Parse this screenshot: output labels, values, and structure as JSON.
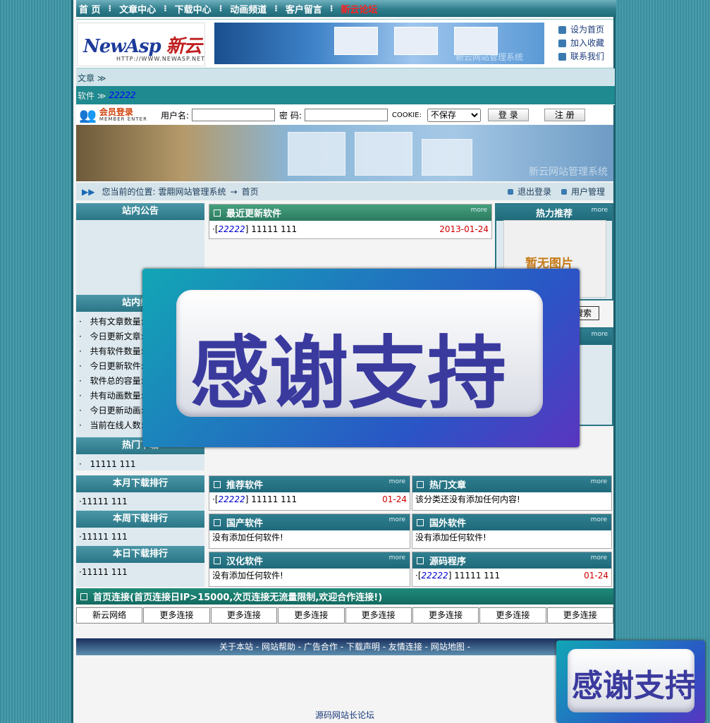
{
  "nav": {
    "items": [
      "首 页",
      "文章中心",
      "下载中心",
      "动画频道",
      "客户留言"
    ],
    "hot": "新云论坛",
    "sep": "⁝"
  },
  "banner": {
    "logo_main": "NewAsp",
    "logo_cn": "新云",
    "logo_url": "HTTP://WWW.NEWASP.NET",
    "img_caption": "新云网站管理系统",
    "quick": [
      "设为首页",
      "加入收藏",
      "联系我们"
    ]
  },
  "crumbs": {
    "article": "文章 ≫",
    "software": "软件 ≫",
    "software_sub": "22222"
  },
  "login": {
    "title": "会员登录",
    "subtitle": "MEMBER ENTER",
    "user_label": "用户名:",
    "pass_label": "密 码:",
    "cookie_label": "COOKIE:",
    "cookie_value": "不保存",
    "login_btn": "登 录",
    "register_btn": "注 册"
  },
  "photo_caption": "新云网站管理系统",
  "position": {
    "prefix": "您当前的位置:",
    "site": "雲翢网站管理系统",
    "arrow": "→",
    "page": "首页",
    "logout": "退出登录",
    "usermgr": "用户管理"
  },
  "left": {
    "notice_title": "站内公告",
    "stats_title": "站内统计",
    "stats": [
      "共有文章数量:",
      "今日更新文章:",
      "共有软件数量:",
      "今日更新软件:",
      "软件总的容量:",
      "共有动画数量:",
      "今日更新动画:",
      "当前在线人数:"
    ],
    "hot_title": "热门下载",
    "hot_items": [
      "11111 111"
    ],
    "month_title": "本月下载排行",
    "month_items": [
      "11111 111"
    ],
    "week_title": "本周下载排行",
    "week_items": [
      "11111 111"
    ],
    "day_title": "本日下载排行",
    "day_items": [
      "11111 111"
    ]
  },
  "recent": {
    "title": "最近更新软件",
    "more": "more",
    "items": [
      {
        "cat": "22222",
        "name": "11111 111",
        "date": "2013-01-24"
      }
    ]
  },
  "right": {
    "hot_title": "热力推荐",
    "more": "more",
    "noimg": "暂无图片",
    "search_btn": "搜索"
  },
  "sections": {
    "recommend": {
      "title": "推荐软件",
      "cat": "22222",
      "name": "11111 111",
      "date": "01-24"
    },
    "hot_article": {
      "title": "热门文章",
      "empty": "该分类还没有添加任何内容!"
    },
    "domestic": {
      "title": "国产软件",
      "empty": "没有添加任何软件!"
    },
    "foreign": {
      "title": "国外软件",
      "empty": "没有添加任何软件!"
    },
    "chinese": {
      "title": "汉化软件",
      "empty": "没有添加任何软件!"
    },
    "source": {
      "title": "源码程序",
      "cat": "22222",
      "name": "11111 111",
      "date": "01-24"
    }
  },
  "links": {
    "title": "首页连接(首页连接日IP>15000,次页连接无流量限制,欢迎合作连接!)",
    "items": [
      "新云网络",
      "更多连接",
      "更多连接",
      "更多连接",
      "更多连接",
      "更多连接",
      "更多连接",
      "更多连接"
    ]
  },
  "footer": {
    "links": "关于本站 - 网站帮助 - 广告合作 - 下载声明 - 友情连接 - 网站地图 -",
    "bottom": "源码网站长论坛"
  },
  "overlay": {
    "text": "感谢支持"
  },
  "colors": {
    "accent": "#2a7686",
    "hot": "#ff2020",
    "date": "#cc0000"
  }
}
